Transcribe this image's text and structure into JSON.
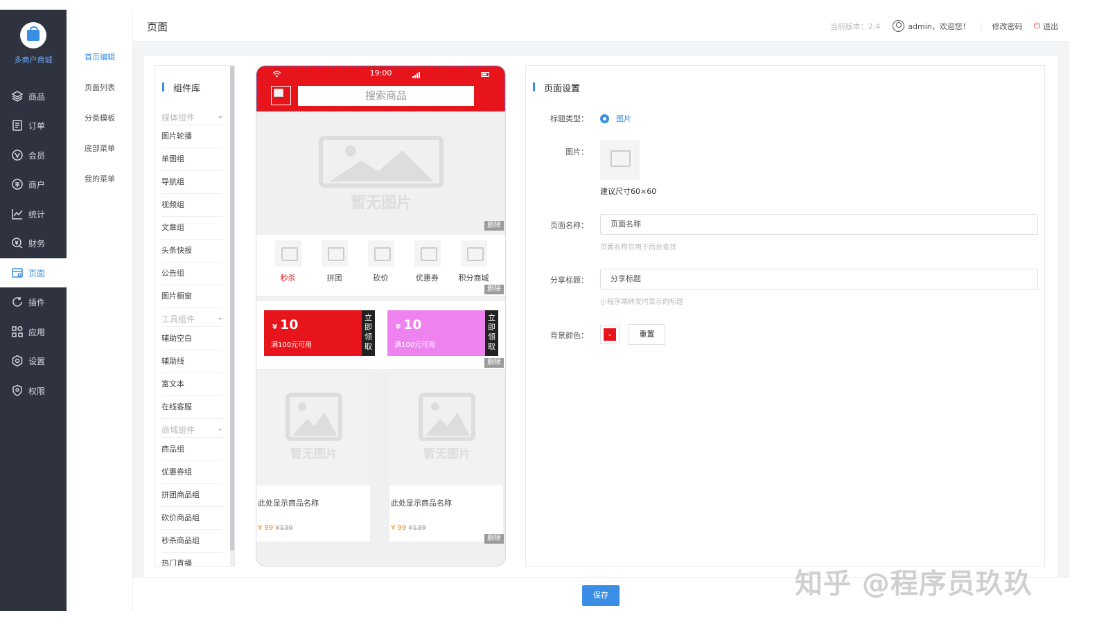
{
  "brand": {
    "name": "多商户商城"
  },
  "nav": [
    {
      "label": "商品",
      "icon": "layers-icon"
    },
    {
      "label": "订单",
      "icon": "order-icon"
    },
    {
      "label": "会员",
      "icon": "member-icon"
    },
    {
      "label": "商户",
      "icon": "merchant-icon"
    },
    {
      "label": "统计",
      "icon": "chart-icon"
    },
    {
      "label": "财务",
      "icon": "finance-icon"
    },
    {
      "label": "页面",
      "icon": "page-icon",
      "active": true
    },
    {
      "label": "插件",
      "icon": "plugin-icon"
    },
    {
      "label": "应用",
      "icon": "apps-icon"
    },
    {
      "label": "设置",
      "icon": "settings-icon"
    },
    {
      "label": "权限",
      "icon": "shield-icon"
    }
  ],
  "subnav": [
    "首页编辑",
    "页面列表",
    "分类模板",
    "底部菜单",
    "我的菜单"
  ],
  "header": {
    "title": "页面",
    "version": "当前版本：2.4",
    "user": "admin，欢迎您！",
    "change_password": "修改密码",
    "logout": "退出"
  },
  "library": {
    "title": "组件库",
    "groups": [
      {
        "name": "媒体组件",
        "items": [
          "图片轮播",
          "单图组",
          "导航组",
          "视频组",
          "文章组",
          "头条快报",
          "公告组",
          "图片橱窗"
        ]
      },
      {
        "name": "工具组件",
        "items": [
          "辅助空白",
          "辅助线",
          "富文本",
          "在线客服"
        ]
      },
      {
        "name": "商城组件",
        "items": [
          "商品组",
          "优惠券组",
          "拼团商品组",
          "砍价商品组",
          "秒杀商品组",
          "热门直播"
        ]
      }
    ]
  },
  "phone": {
    "time": "19:00",
    "search_placeholder": "搜索商品",
    "no_image": "暂无图片",
    "delete": "删除",
    "nav_items": [
      "秒杀",
      "拼团",
      "砍价",
      "优惠券",
      "积分商城"
    ],
    "coupons": [
      {
        "currency": "¥",
        "amount": "10",
        "condition": "满100元可用",
        "action": "立即领取",
        "color": "#e8141b"
      },
      {
        "currency": "¥",
        "amount": "10",
        "condition": "满100元可用",
        "action": "立即领取",
        "color": "#ee82ee"
      }
    ],
    "goods": [
      {
        "name": "此处显示商品名称",
        "price": "¥ 99",
        "original": "¥139"
      },
      {
        "name": "此处显示商品名称",
        "price": "¥ 99",
        "original": "¥139"
      }
    ]
  },
  "settings": {
    "title": "页面设置",
    "title_type_label": "标题类型：",
    "title_type_value": "图片",
    "image_label": "图片：",
    "image_hint": "建议尺寸60×60",
    "page_name_label": "页面名称：",
    "page_name_placeholder": "页面名称",
    "page_name_hint": "页面名称仅用于后台查找",
    "share_label": "分享标题：",
    "share_placeholder": "分享标题",
    "share_hint": "小程序端转发时显示的标题",
    "bg_label": "背景颜色：",
    "bg_color": "#e8141b",
    "reset": "重置"
  },
  "footer": {
    "save": "保存"
  },
  "watermark": "知乎 @程序员玖玖"
}
